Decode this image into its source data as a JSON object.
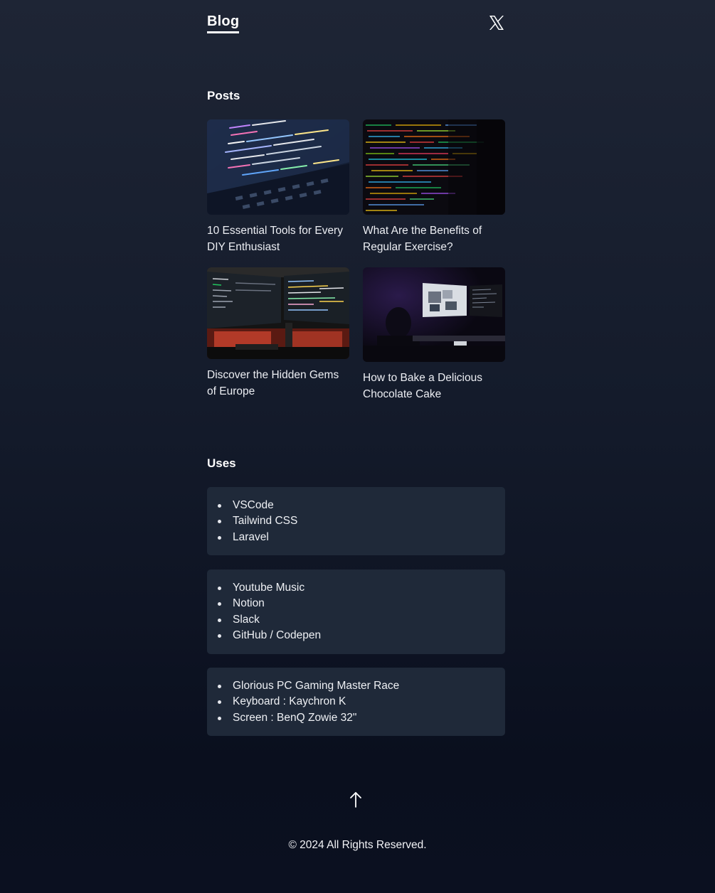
{
  "header": {
    "brand": "Blog",
    "social_icon": "x-logo-icon"
  },
  "posts": {
    "title": "Posts",
    "items": [
      {
        "title": "10 Essential Tools for Every DIY Enthusiast",
        "thumbnail": "laptop-code-closeup-image"
      },
      {
        "title": "What Are the Benefits of Regular Exercise?",
        "thumbnail": "colorful-code-screen-image"
      },
      {
        "title": "Discover the Hidden Gems of Europe",
        "thumbnail": "dual-monitor-desk-image"
      },
      {
        "title": "How to Bake a Delicious Chocolate Cake",
        "thumbnail": "dark-room-monitor-image"
      }
    ]
  },
  "uses": {
    "title": "Uses",
    "groups": [
      [
        "VSCode",
        "Tailwind CSS",
        "Laravel"
      ],
      [
        "Youtube Music",
        "Notion",
        "Slack",
        "GitHub / Codepen"
      ],
      [
        "Glorious PC Gaming Master Race",
        "Keyboard : Kaychron K",
        "Screen : BenQ Zowie 32\""
      ]
    ]
  },
  "scroll_top_icon": "arrow-up-icon",
  "footer": {
    "copyright": "© 2024 All Rights Reserved."
  },
  "colors": {
    "background_top": "#1e2535",
    "background_bottom": "#0a0f1e",
    "card": "#1f2939",
    "text": "#eef0f4"
  }
}
